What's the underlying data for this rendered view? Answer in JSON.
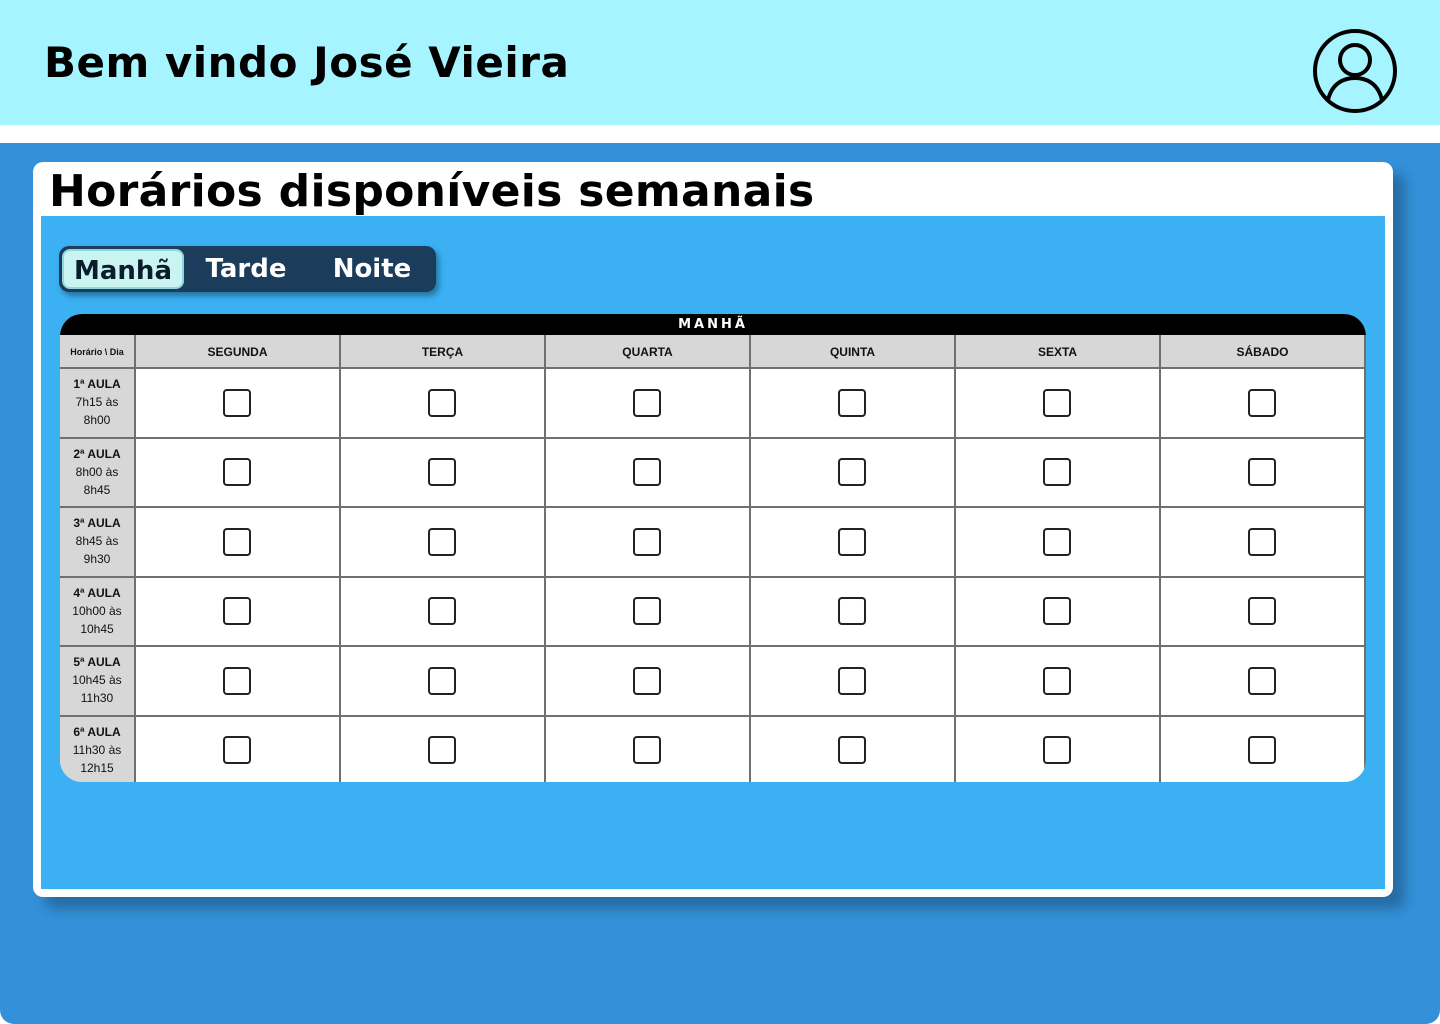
{
  "header": {
    "welcome_text": "Bem vindo José Vieira",
    "avatar_icon": "user-profile-icon"
  },
  "card": {
    "title": "Horários disponíveis semanais"
  },
  "tabs": {
    "items": [
      {
        "label": "Manhã",
        "active": true
      },
      {
        "label": "Tarde",
        "active": false
      },
      {
        "label": "Noite",
        "active": false
      }
    ]
  },
  "schedule": {
    "period_title": "MANHÃ",
    "corner_label": "Horário \\ Dia",
    "days": [
      "SEGUNDA",
      "TERÇA",
      "QUARTA",
      "QUINTA",
      "SEXTA",
      "SÁBADO"
    ],
    "slots": [
      {
        "label": "1ª AULA",
        "start": "7h15 às",
        "end": "8h00"
      },
      {
        "label": "2ª AULA",
        "start": "8h00 às",
        "end": "8h45"
      },
      {
        "label": "3ª AULA",
        "start": "8h45 às",
        "end": "9h30"
      },
      {
        "label": "4ª AULA",
        "start": "10h00 às",
        "end": "10h45"
      },
      {
        "label": "5ª AULA",
        "start": "10h45 às",
        "end": "11h30"
      },
      {
        "label": "6ª AULA",
        "start": "11h30 às",
        "end": "12h15"
      }
    ],
    "checked": [
      [
        false,
        false,
        false,
        false,
        false,
        false
      ],
      [
        false,
        false,
        false,
        false,
        false,
        false
      ],
      [
        false,
        false,
        false,
        false,
        false,
        false
      ],
      [
        false,
        false,
        false,
        false,
        false,
        false
      ],
      [
        false,
        false,
        false,
        false,
        false,
        false
      ],
      [
        false,
        false,
        false,
        false,
        false,
        false
      ]
    ]
  },
  "colors": {
    "header_bg": "#a6f4ff",
    "page_bg": "#3390d9",
    "panel_bg": "#3bb0f3",
    "tabs_bg": "#1b3c5b",
    "active_tab_bg": "#c9f4f2"
  }
}
